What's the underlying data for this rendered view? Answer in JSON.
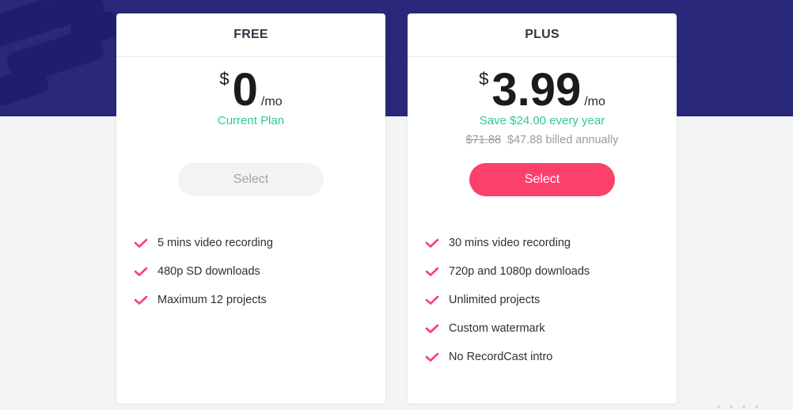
{
  "colors": {
    "hero_bg": "#29287b",
    "page_bg": "#f3f4f6",
    "accent": "#fb406b",
    "success": "#2ecc8a",
    "muted": "#9a9ba3"
  },
  "plans": [
    {
      "name": "FREE",
      "currency": "$",
      "amount": "0",
      "period": "/mo",
      "note": "Current Plan",
      "billing_old": "",
      "billing_text": "",
      "button": {
        "label": "Select",
        "state": "disabled"
      },
      "features": [
        {
          "icon": "check-icon",
          "label": "5 mins video recording"
        },
        {
          "icon": "check-icon",
          "label": "480p SD downloads"
        },
        {
          "icon": "check-icon",
          "label": "Maximum 12 projects"
        }
      ]
    },
    {
      "name": "PLUS",
      "currency": "$",
      "amount": "3.99",
      "period": "/mo",
      "note": "Save $24.00 every year",
      "billing_old": "$71.88",
      "billing_text": "$47.88 billed annually",
      "button": {
        "label": "Select",
        "state": "primary"
      },
      "features": [
        {
          "icon": "check-icon",
          "label": "30 mins video recording"
        },
        {
          "icon": "check-icon",
          "label": "720p and 1080p downloads"
        },
        {
          "icon": "check-icon",
          "label": "Unlimited projects"
        },
        {
          "icon": "check-icon",
          "label": "Custom watermark"
        },
        {
          "icon": "check-icon",
          "label": "No RecordCast intro"
        }
      ]
    }
  ]
}
